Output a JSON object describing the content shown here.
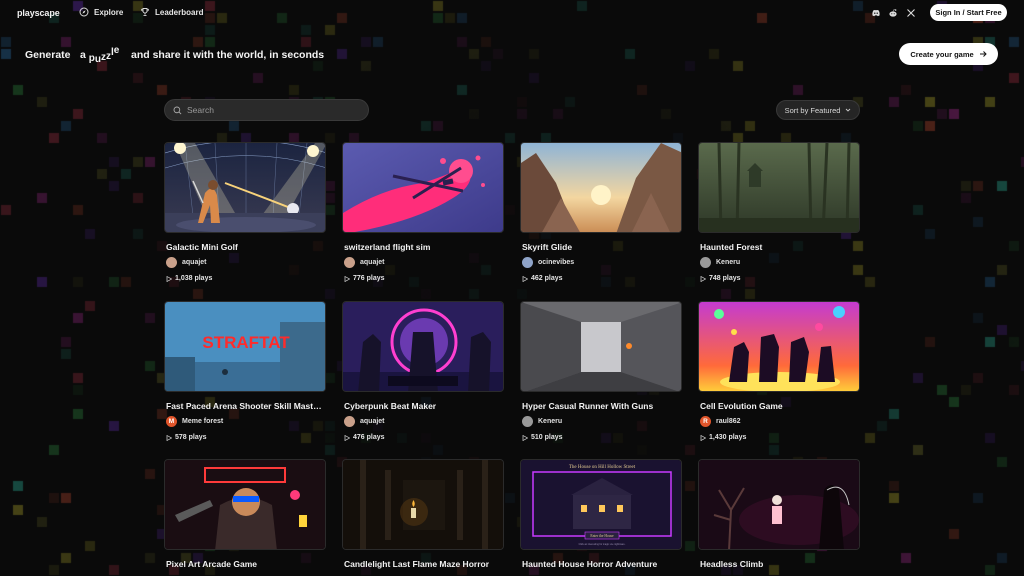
{
  "app": {
    "name": "playscape"
  },
  "nav": {
    "explore": "Explore",
    "leaderboard": "Leaderboard",
    "sign_in": "Sign In / Start Free",
    "social_icons": [
      "discord-icon",
      "reddit-icon",
      "x-icon"
    ]
  },
  "hero": {
    "prefix": "Generate",
    "word1": "a",
    "word2": "puzzle",
    "suffix": "and share it with the world, in seconds",
    "create_button": "Create your game"
  },
  "toolbar": {
    "search_placeholder": "Search",
    "sort_label": "Sort by Featured"
  },
  "games": [
    {
      "title": "Galactic Mini Golf",
      "author": "aquajet",
      "plays": "1,038 plays",
      "avatar_letter": "",
      "avatar_color": "#c9a08a"
    },
    {
      "title": "switzerland flight sim",
      "author": "aquajet",
      "plays": "776 plays",
      "avatar_letter": "",
      "avatar_color": "#c9a08a"
    },
    {
      "title": "Skyrift Glide",
      "author": "ocinevibes",
      "plays": "462 plays",
      "avatar_letter": "",
      "avatar_color": "#8fa4c9"
    },
    {
      "title": "Haunted Forest",
      "author": "Keneru",
      "plays": "748 plays",
      "avatar_letter": "",
      "avatar_color": "#9a9a9a"
    },
    {
      "title": "Fast Paced Arena Shooter Skill Mastery",
      "author": "Meme forest",
      "plays": "578 plays",
      "avatar_letter": "M",
      "avatar_color": "#e0552b"
    },
    {
      "title": "Cyberpunk Beat Maker",
      "author": "aquajet",
      "plays": "476 plays",
      "avatar_letter": "",
      "avatar_color": "#c9a08a"
    },
    {
      "title": "Hyper Casual Runner With Guns",
      "author": "Keneru",
      "plays": "510 plays",
      "avatar_letter": "",
      "avatar_color": "#9a9a9a"
    },
    {
      "title": "Cell Evolution Game",
      "author": "raul862",
      "plays": "1,430 plays",
      "avatar_letter": "R",
      "avatar_color": "#e0552b"
    },
    {
      "title": "Pixel Art Arcade Game",
      "author": "",
      "plays": "",
      "avatar_letter": "",
      "avatar_color": "#3aa0b0"
    },
    {
      "title": "Candlelight Last Flame Maze Horror",
      "author": "",
      "plays": "",
      "avatar_letter": "",
      "avatar_color": "#888888"
    },
    {
      "title": "Haunted House Horror Adventure",
      "author": "",
      "plays": "",
      "avatar_letter": "",
      "avatar_color": "#888888"
    },
    {
      "title": "Headless Climb",
      "author": "",
      "plays": "",
      "avatar_letter": "",
      "avatar_color": "#888888"
    }
  ],
  "thumb_text": {
    "straftat": "STRAFTAT",
    "haunted_house_banner": "The House on Hill Hollow Street",
    "haunted_house_button": "Enter the House",
    "haunted_house_caption": "Click an interesting for magic ure nightmare."
  },
  "colors": {
    "accent_white": "#ffffff",
    "background": "#0a0a0a",
    "avatar_orange": "#e0552b"
  }
}
